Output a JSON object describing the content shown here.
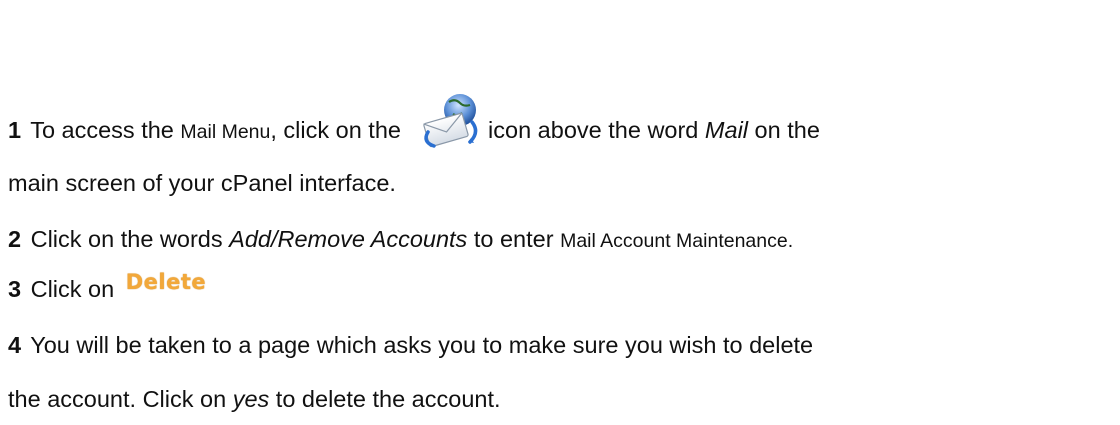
{
  "step1": {
    "number": "1",
    "text_a": "To access the",
    "text_b": "Mail Menu",
    "text_c": ", click on the",
    "icon": "mail-icon",
    "text_d": "icon above the word",
    "text_e": "Mail",
    "text_f": "on the",
    "text_g": "main screen of your cPanel interface."
  },
  "step2": {
    "number": "2",
    "text_a": "Click on the words",
    "text_b": "Add/Remove Accounts",
    "text_c": "to enter",
    "text_d": "Mail Account Maintenance."
  },
  "step3": {
    "number": "3",
    "text_a": "Click on",
    "button_label": "Delete"
  },
  "step4": {
    "number": "4",
    "text_a": "You will be taken to a page which asks you to make sure you wish to delete",
    "text_b": "the account. Click on",
    "text_c": "yes",
    "text_d": "to delete the account."
  }
}
